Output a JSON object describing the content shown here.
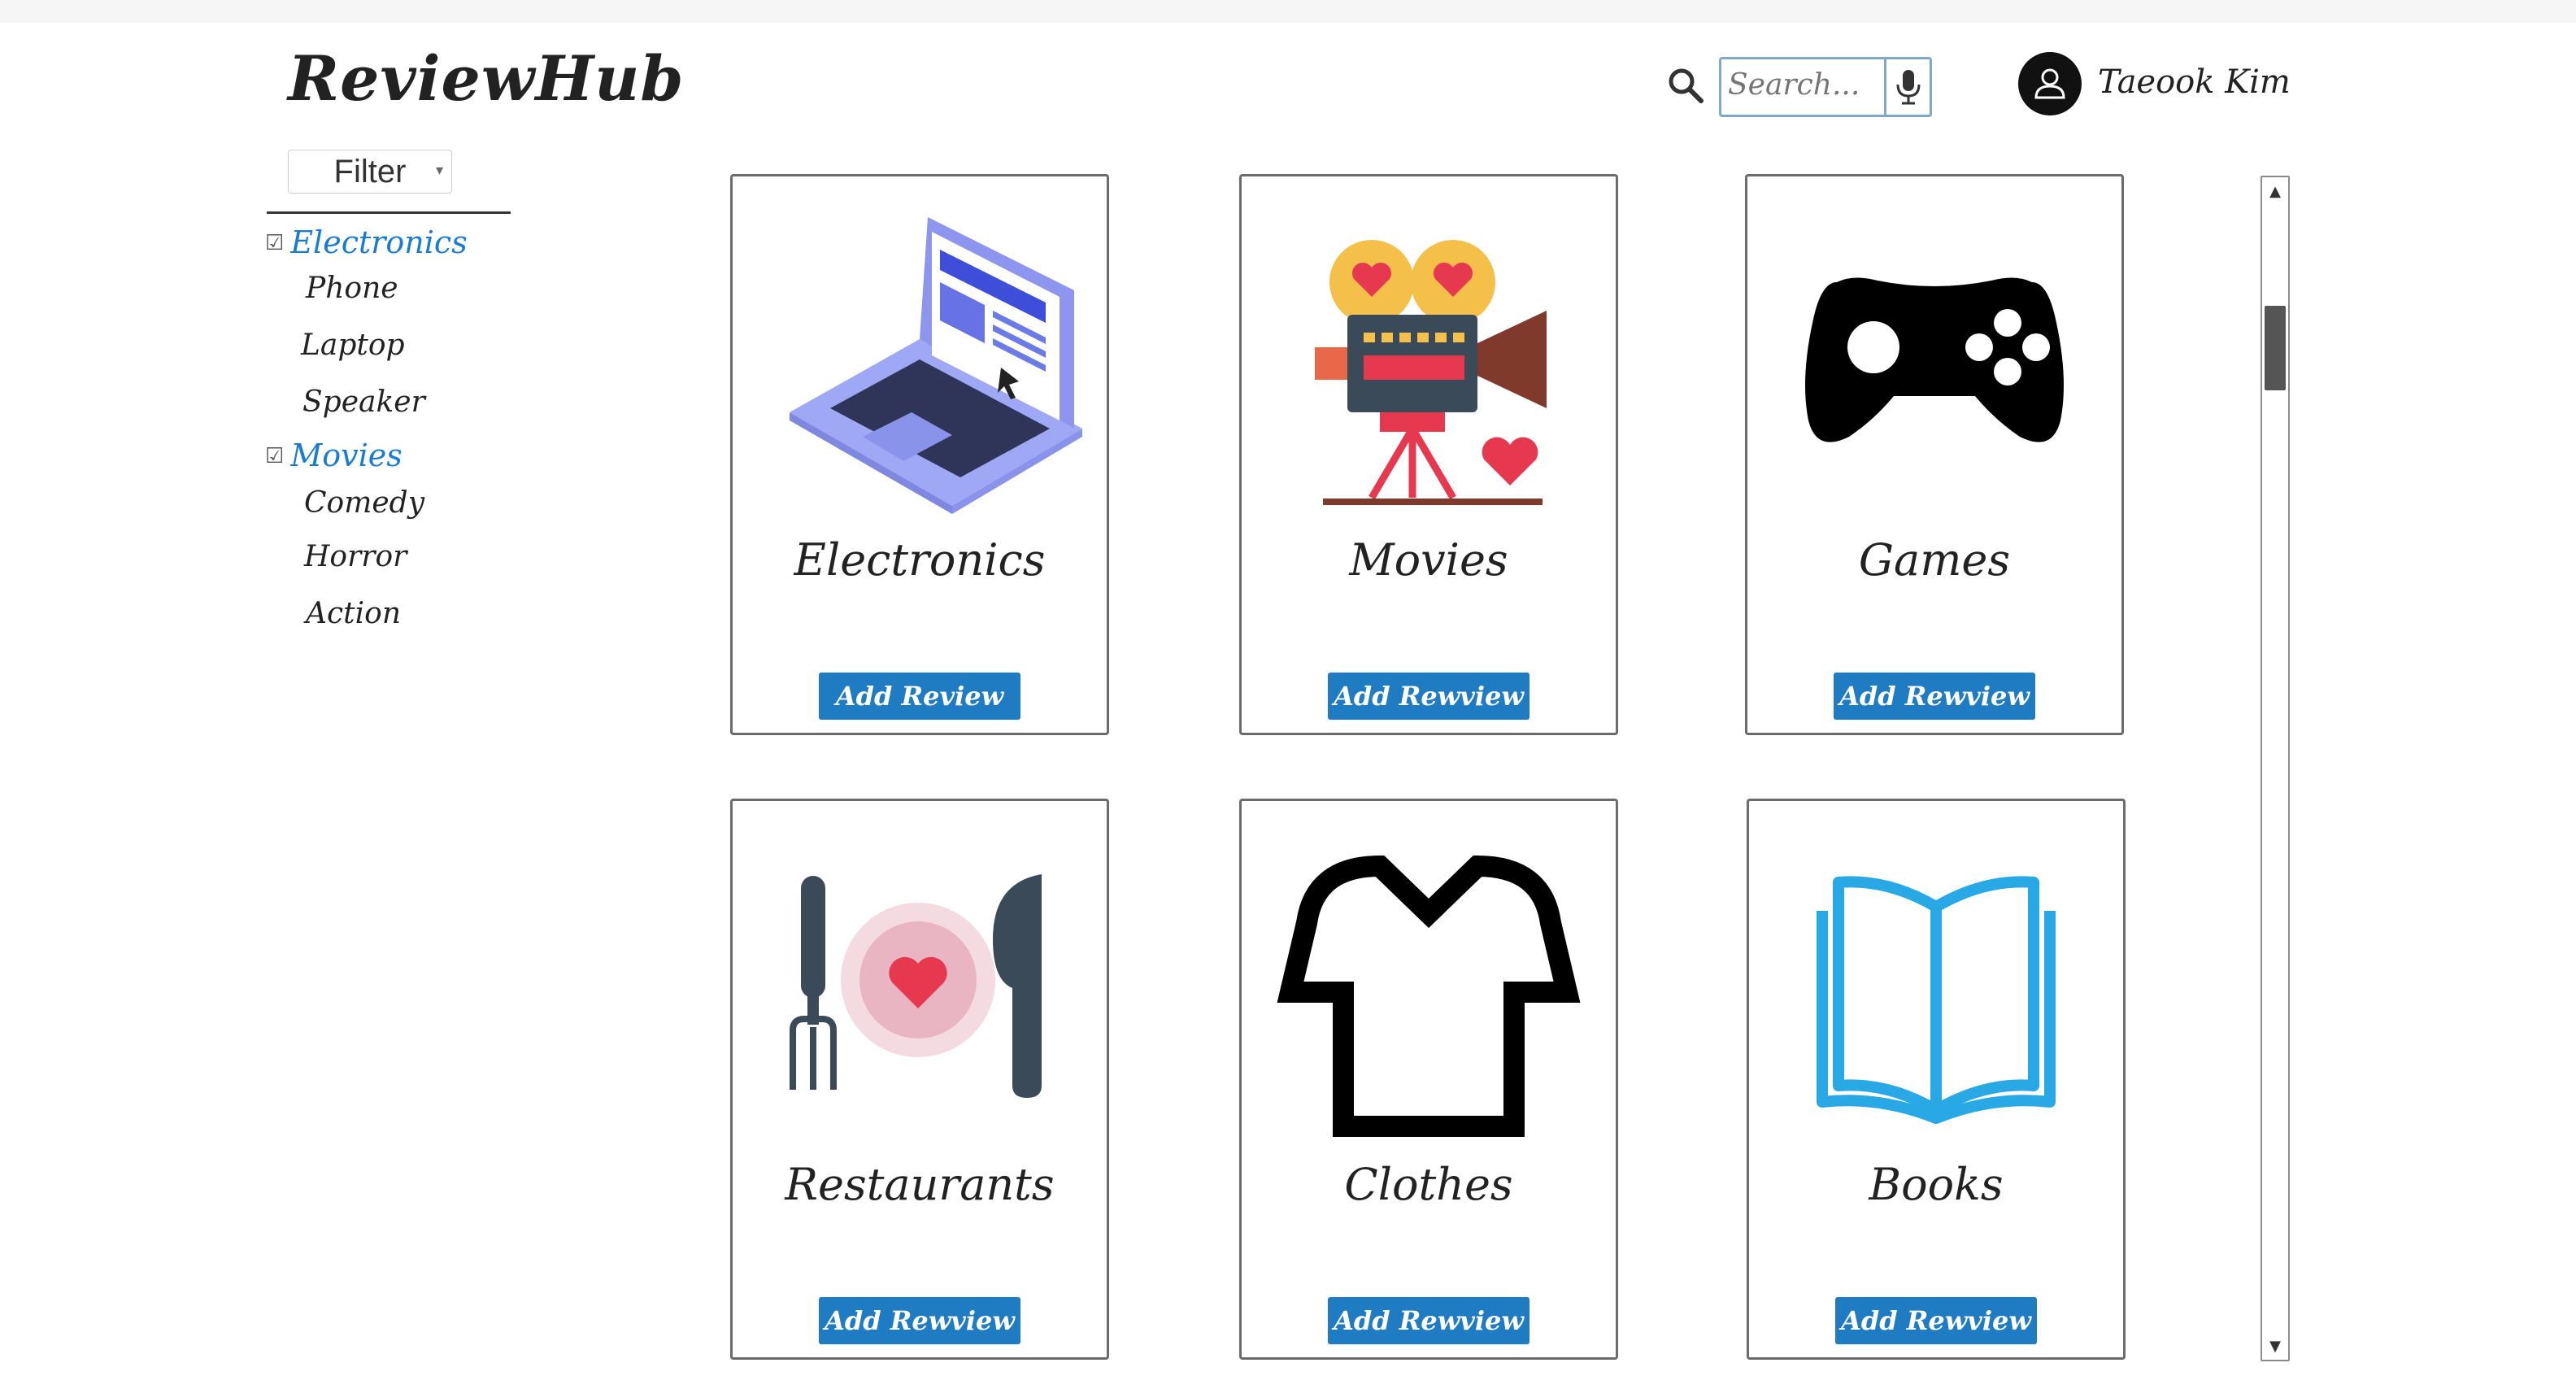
{
  "app": {
    "brand": "ReviewHub"
  },
  "filter": {
    "label": "Filter",
    "categories": [
      {
        "label": "Electronics",
        "checked": true,
        "subs": [
          "Phone",
          "Laptop",
          "Speaker"
        ]
      },
      {
        "label": "Movies",
        "checked": true,
        "subs": [
          "Comedy",
          "Horror",
          "Action"
        ]
      }
    ]
  },
  "header": {
    "search_placeholder": "Search...",
    "user_name": "Taeook Kim"
  },
  "cards": [
    {
      "title": "Electronics",
      "button": "Add Review",
      "icon": "laptop-icon"
    },
    {
      "title": "Movies",
      "button": "Add Rewview",
      "icon": "movie-projector-icon"
    },
    {
      "title": "Games",
      "button": "Add Rewview",
      "icon": "gamepad-icon"
    },
    {
      "title": "Restaurants",
      "button": "Add Rewview",
      "icon": "restaurant-plate-icon"
    },
    {
      "title": "Clothes",
      "button": "Add Rewview",
      "icon": "shirt-icon"
    },
    {
      "title": "Books",
      "button": "Add Rewview",
      "icon": "book-icon"
    }
  ],
  "colors": {
    "accent": "#1f7bc2",
    "category_heading": "#1a7bd3",
    "search_border": "#7fa8c9"
  }
}
